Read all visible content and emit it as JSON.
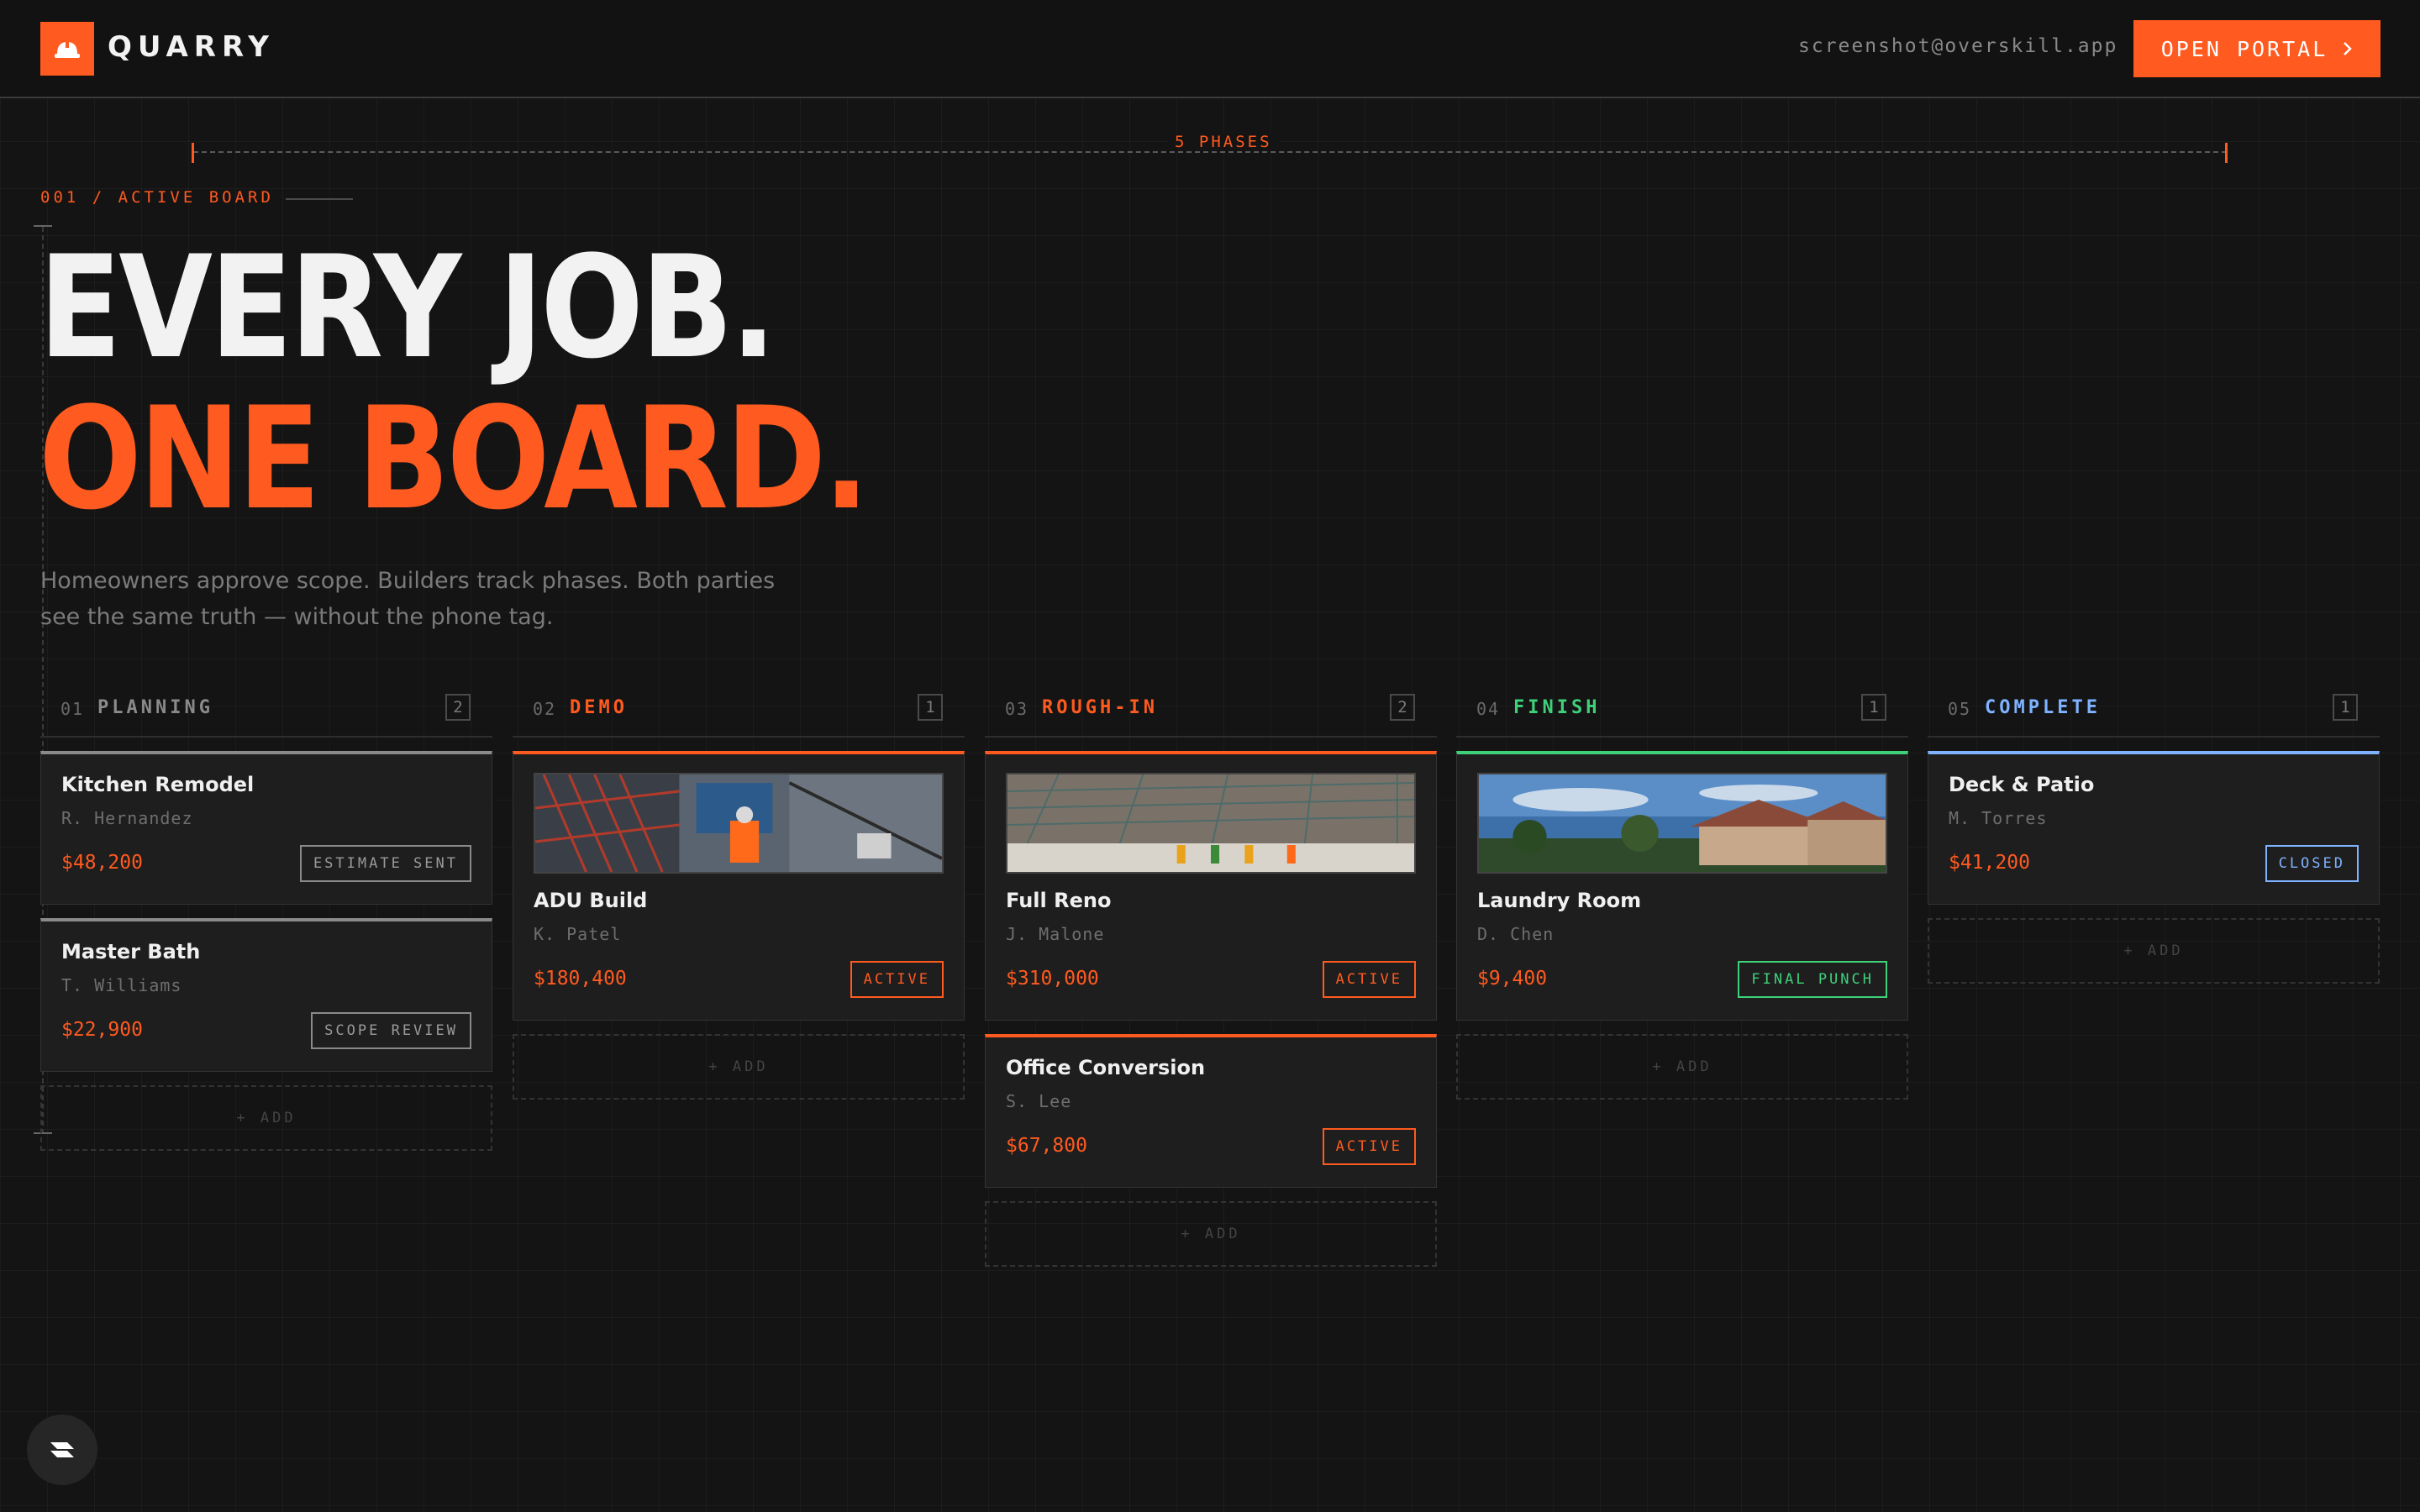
{
  "header": {
    "brand": "QUARRY",
    "email": "screenshot@overskill.app",
    "portal_button": "OPEN PORTAL",
    "portal_icon": "chevron-right-icon",
    "logo_icon": "hard-hat-icon"
  },
  "colors": {
    "accent": "#ff5a1f",
    "finish": "#3fd17a",
    "complete": "#7fb2ff",
    "planning": "#8a8a8a"
  },
  "ruler": {
    "label": "5 PHASES"
  },
  "section": {
    "label": "001 / ACTIVE BOARD"
  },
  "hero": {
    "line1": "EVERY JOB.",
    "line2": "ONE BOARD.",
    "sub": "Homeowners approve scope. Builders track phases. Both parties see the same truth — without the phone tag."
  },
  "add_label": "+ ADD",
  "columns": [
    {
      "num": "01",
      "name": "PLANNING",
      "count": "2",
      "cards": [
        {
          "title": "Kitchen Remodel",
          "owner": "R. Hernandez",
          "price": "$48,200",
          "status": "ESTIMATE SENT"
        },
        {
          "title": "Master Bath",
          "owner": "T. Williams",
          "price": "$22,900",
          "status": "SCOPE REVIEW"
        }
      ]
    },
    {
      "num": "02",
      "name": "DEMO",
      "count": "1",
      "cards": [
        {
          "title": "ADU Build",
          "owner": "K. Patel",
          "price": "$180,400",
          "status": "ACTIVE",
          "image": "construction-site-photo"
        }
      ]
    },
    {
      "num": "03",
      "name": "ROUGH-IN",
      "count": "2",
      "cards": [
        {
          "title": "Full Reno",
          "owner": "J. Malone",
          "price": "$310,000",
          "status": "ACTIVE",
          "image": "foundation-rebar-photo"
        },
        {
          "title": "Office Conversion",
          "owner": "S. Lee",
          "price": "$67,800",
          "status": "ACTIVE"
        }
      ]
    },
    {
      "num": "04",
      "name": "FINISH",
      "count": "1",
      "cards": [
        {
          "title": "Laundry Room",
          "owner": "D. Chen",
          "price": "$9,400",
          "status": "FINAL PUNCH",
          "image": "house-exterior-photo"
        }
      ]
    },
    {
      "num": "05",
      "name": "COMPLETE",
      "count": "1",
      "cards": [
        {
          "title": "Deck & Patio",
          "owner": "M. Torres",
          "price": "$41,200",
          "status": "CLOSED"
        }
      ]
    }
  ]
}
